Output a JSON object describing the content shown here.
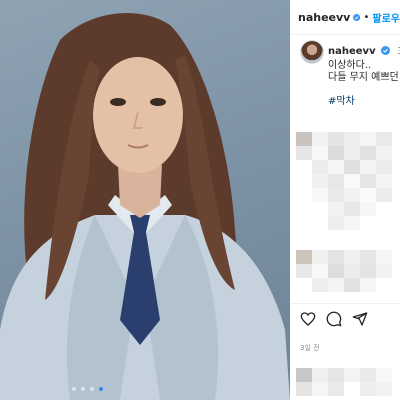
{
  "post": {
    "username": "naheevv",
    "follow_label": "팔로우",
    "separator": "•"
  },
  "caption": {
    "username": "naheevv",
    "time": "3일",
    "line1": "이상하다..",
    "line2": "다들 무지 예쁘던",
    "hashtag": "#막차"
  },
  "footer": {
    "ago": "3일 전"
  },
  "carousel": {
    "count": 4,
    "active_index": 3
  },
  "colors": {
    "accent": "#0095f6",
    "verified": "#3897f0"
  },
  "icons": [
    "verified-badge-icon",
    "heart-icon",
    "comment-icon",
    "share-icon"
  ]
}
